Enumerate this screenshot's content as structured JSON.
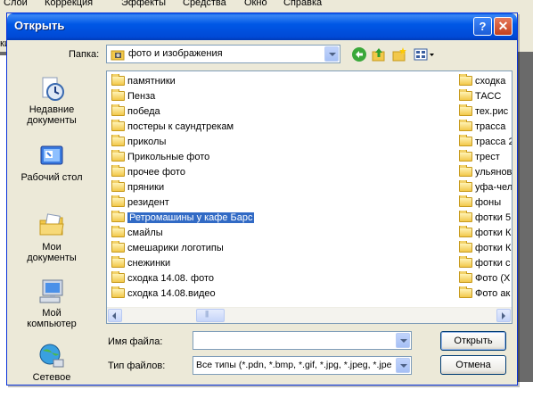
{
  "background": {
    "menu": [
      "Слой",
      "Коррекция",
      "Эффекты",
      "Средства",
      "Окно",
      "Справка"
    ],
    "toolbar_text": "кие"
  },
  "dialog": {
    "title": "Открыть",
    "folder_label": "Папка:",
    "folder_value": "фото и изображения",
    "places": [
      {
        "label": "Недавние документы",
        "icon": "recent-documents-icon"
      },
      {
        "label": "Рабочий стол",
        "icon": "desktop-icon"
      },
      {
        "label": "Мои документы",
        "icon": "my-documents-icon"
      },
      {
        "label": "Мой компьютер",
        "icon": "my-computer-icon"
      },
      {
        "label": "Сетевое",
        "icon": "network-icon"
      }
    ],
    "files_col1": [
      "памятники",
      "Пенза",
      "победа",
      "постеры к саундтрекам",
      "приколы",
      "Прикольные фото",
      "прочее фото",
      "пряники",
      "резидент",
      "Ретромашины у кафе Барс",
      "смайлы",
      "смешарики логотипы",
      "снежинки",
      "сходка 14.08. фото",
      "сходка 14.08.видео"
    ],
    "selected_index": 9,
    "files_col2": [
      "сходка",
      "ТАСС",
      "тех.рис",
      "трасса",
      "трасса 2",
      "трест",
      "ульянов",
      "уфа-чел",
      "фоны",
      "фотки 5",
      "фотки К",
      "фотки К",
      "фотки с",
      "Фото (Х",
      "Фото ак"
    ],
    "filename_label": "Имя файла:",
    "filename_value": "",
    "filetype_label": "Тип файлов:",
    "filetype_value": "Все типы (*.pdn, *.bmp, *.gif, *.jpg, *.jpeg, *.jpe",
    "open_button": "Открыть",
    "cancel_button": "Отмена"
  }
}
